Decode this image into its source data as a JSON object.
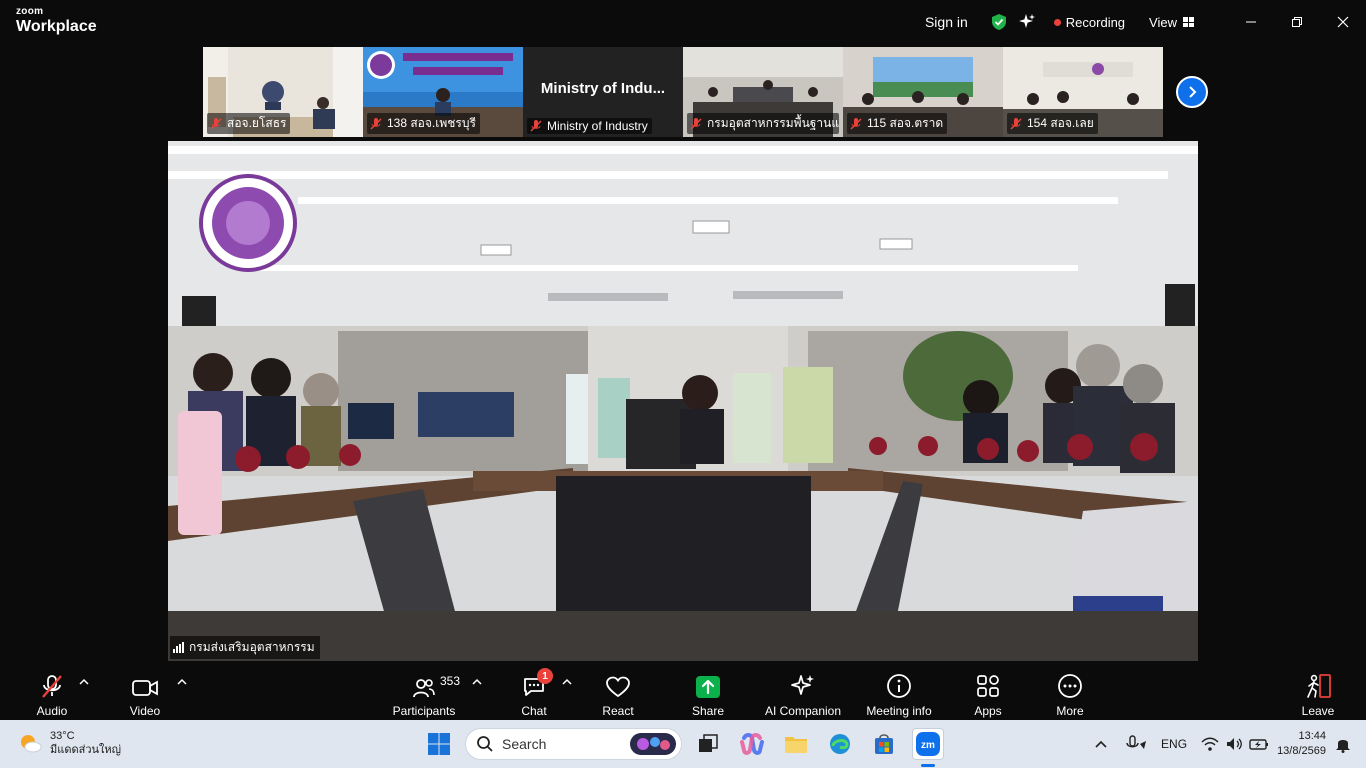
{
  "app": {
    "brand_top": "zoom",
    "brand_bottom": "Workplace"
  },
  "titlebar": {
    "signin": "Sign in",
    "recording": "Recording",
    "view": "View"
  },
  "thumbnails": [
    {
      "label": "สอจ.ยโสธร",
      "muted": true
    },
    {
      "label": "138 สอจ.เพชรบุรี",
      "muted": true
    },
    {
      "label": "Ministry of Industry",
      "muted": true,
      "display_name": "Ministry of Indu..."
    },
    {
      "label": "กรมอุตสาหกรรมพื้นฐานแ...",
      "muted": true
    },
    {
      "label": "115 สอจ.ตราด",
      "muted": true
    },
    {
      "label": "154 สอจ.เลย",
      "muted": true
    }
  ],
  "main_video": {
    "speaker_label": "กรมส่งเสริมอุตสาหกรรม"
  },
  "toolbar": {
    "audio": "Audio",
    "video": "Video",
    "participants": "Participants",
    "participants_count": "353",
    "chat": "Chat",
    "chat_badge": "1",
    "react": "React",
    "share": "Share",
    "ai_companion": "AI Companion",
    "meeting_info": "Meeting info",
    "apps": "Apps",
    "more": "More",
    "leave": "Leave"
  },
  "taskbar": {
    "temperature": "33°C",
    "weather_desc": "มีแดดส่วนใหญ่",
    "search": "Search",
    "language": "ENG",
    "time": "13:44",
    "date": "13/8/2569"
  },
  "colors": {
    "accent_blue": "#0e71eb",
    "share_green": "#0bb24b",
    "mute_red": "#e8423a",
    "leave_red": "#e8423a"
  }
}
